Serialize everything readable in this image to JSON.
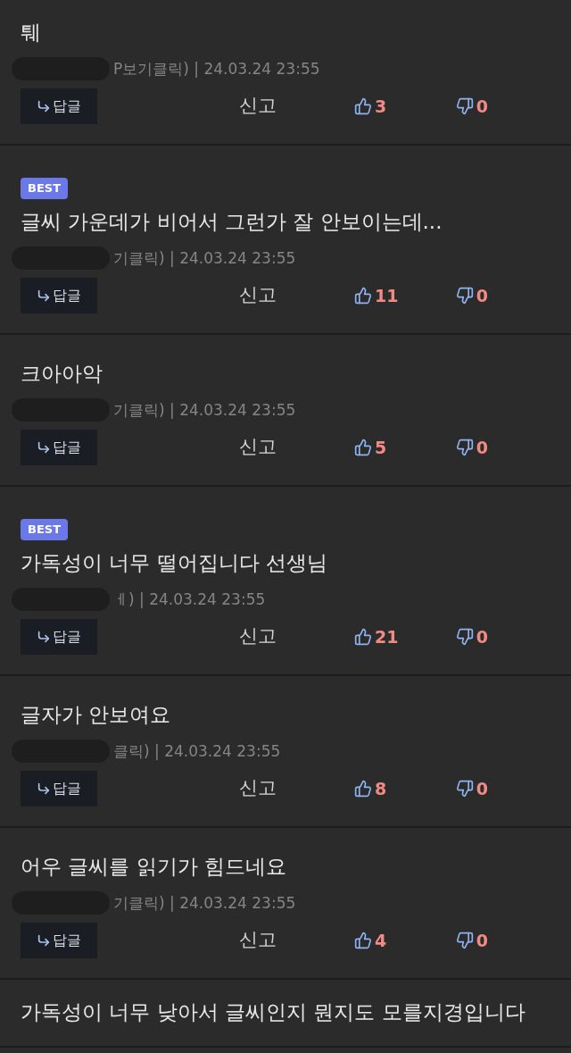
{
  "comments": [
    {
      "best": false,
      "text": "퉤",
      "meta": "P보기클릭) | 24.03.24 23:55",
      "reply": "답글",
      "report": "신고",
      "likes": "3",
      "dislikes": "0"
    },
    {
      "best": true,
      "badge": "BEST",
      "text": "글씨 가운데가 비어서 그런가 잘 안보이는데...",
      "meta": "기클릭) | 24.03.24 23:55",
      "reply": "답글",
      "report": "신고",
      "likes": "11",
      "dislikes": "0"
    },
    {
      "best": false,
      "text": "크아아악",
      "meta": "기클릭) | 24.03.24 23:55",
      "reply": "답글",
      "report": "신고",
      "likes": "5",
      "dislikes": "0"
    },
    {
      "best": true,
      "badge": "BEST",
      "text": "가독성이 너무 떨어집니다 선생님",
      "meta": "ㅔ) | 24.03.24 23:55",
      "reply": "답글",
      "report": "신고",
      "likes": "21",
      "dislikes": "0"
    },
    {
      "best": false,
      "text": "글자가 안보여요",
      "meta": "클릭) | 24.03.24 23:55",
      "reply": "답글",
      "report": "신고",
      "likes": "8",
      "dislikes": "0"
    },
    {
      "best": false,
      "text": "어우 글씨를 읽기가 힘드네요",
      "meta": "기클릭) | 24.03.24 23:55",
      "reply": "답글",
      "report": "신고",
      "likes": "4",
      "dislikes": "0"
    },
    {
      "best": false,
      "text": "가독성이 너무 낮아서 글씨인지 뭔지도 모를지경입니다"
    }
  ]
}
